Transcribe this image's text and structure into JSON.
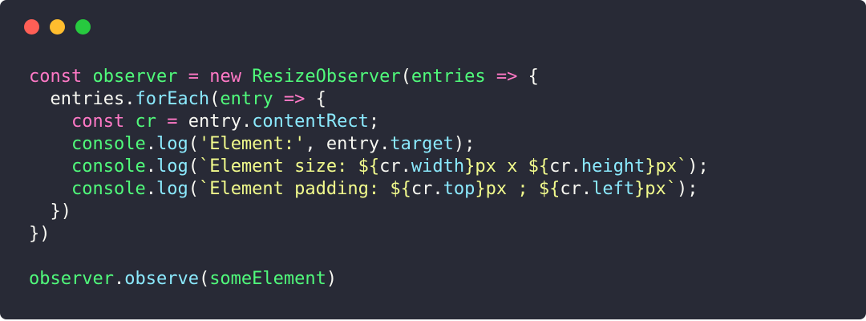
{
  "window": {
    "background": "#282a36",
    "traffic_lights": [
      {
        "name": "close",
        "color": "#ff5f56"
      },
      {
        "name": "minimize",
        "color": "#ffbd2e"
      },
      {
        "name": "maximize",
        "color": "#27c93f"
      }
    ]
  },
  "colors": {
    "plain": "#f8f8f2",
    "keyword": "#ff79c6",
    "function": "#50fa7b",
    "property": "#8be9fd",
    "string": "#f1fa8c"
  },
  "code_lines": [
    [
      {
        "text": "const",
        "kind": "keyword"
      },
      {
        "text": " ",
        "kind": "plain"
      },
      {
        "text": "observer",
        "kind": "function"
      },
      {
        "text": " ",
        "kind": "plain"
      },
      {
        "text": "=",
        "kind": "keyword"
      },
      {
        "text": " ",
        "kind": "plain"
      },
      {
        "text": "new",
        "kind": "keyword"
      },
      {
        "text": " ",
        "kind": "plain"
      },
      {
        "text": "ResizeObserver",
        "kind": "function"
      },
      {
        "text": "(",
        "kind": "plain"
      },
      {
        "text": "entries",
        "kind": "function"
      },
      {
        "text": " ",
        "kind": "plain"
      },
      {
        "text": "=>",
        "kind": "keyword"
      },
      {
        "text": " {",
        "kind": "plain"
      }
    ],
    [
      {
        "text": "  entries.",
        "kind": "plain"
      },
      {
        "text": "forEach",
        "kind": "property"
      },
      {
        "text": "(",
        "kind": "plain"
      },
      {
        "text": "entry",
        "kind": "function"
      },
      {
        "text": " ",
        "kind": "plain"
      },
      {
        "text": "=>",
        "kind": "keyword"
      },
      {
        "text": " {",
        "kind": "plain"
      }
    ],
    [
      {
        "text": "    ",
        "kind": "plain"
      },
      {
        "text": "const",
        "kind": "keyword"
      },
      {
        "text": " ",
        "kind": "plain"
      },
      {
        "text": "cr",
        "kind": "function"
      },
      {
        "text": " ",
        "kind": "plain"
      },
      {
        "text": "=",
        "kind": "keyword"
      },
      {
        "text": " entry.",
        "kind": "plain"
      },
      {
        "text": "contentRect",
        "kind": "property"
      },
      {
        "text": ";",
        "kind": "plain"
      }
    ],
    [
      {
        "text": "    ",
        "kind": "plain"
      },
      {
        "text": "console",
        "kind": "function"
      },
      {
        "text": ".",
        "kind": "plain"
      },
      {
        "text": "log",
        "kind": "property"
      },
      {
        "text": "(",
        "kind": "plain"
      },
      {
        "text": "'Element:'",
        "kind": "string"
      },
      {
        "text": ", entry.",
        "kind": "plain"
      },
      {
        "text": "target",
        "kind": "property"
      },
      {
        "text": ");",
        "kind": "plain"
      }
    ],
    [
      {
        "text": "    ",
        "kind": "plain"
      },
      {
        "text": "console",
        "kind": "function"
      },
      {
        "text": ".",
        "kind": "plain"
      },
      {
        "text": "log",
        "kind": "property"
      },
      {
        "text": "(",
        "kind": "plain"
      },
      {
        "text": "`Element size: ${",
        "kind": "string"
      },
      {
        "text": "cr.",
        "kind": "plain"
      },
      {
        "text": "width",
        "kind": "property"
      },
      {
        "text": "}px x ${",
        "kind": "string"
      },
      {
        "text": "cr.",
        "kind": "plain"
      },
      {
        "text": "height",
        "kind": "property"
      },
      {
        "text": "}px`",
        "kind": "string"
      },
      {
        "text": ");",
        "kind": "plain"
      }
    ],
    [
      {
        "text": "    ",
        "kind": "plain"
      },
      {
        "text": "console",
        "kind": "function"
      },
      {
        "text": ".",
        "kind": "plain"
      },
      {
        "text": "log",
        "kind": "property"
      },
      {
        "text": "(",
        "kind": "plain"
      },
      {
        "text": "`Element padding: ${",
        "kind": "string"
      },
      {
        "text": "cr.",
        "kind": "plain"
      },
      {
        "text": "top",
        "kind": "property"
      },
      {
        "text": "}px ; ${",
        "kind": "string"
      },
      {
        "text": "cr.",
        "kind": "plain"
      },
      {
        "text": "left",
        "kind": "property"
      },
      {
        "text": "}px`",
        "kind": "string"
      },
      {
        "text": ");",
        "kind": "plain"
      }
    ],
    [
      {
        "text": "  })",
        "kind": "plain"
      }
    ],
    [
      {
        "text": "})",
        "kind": "plain"
      }
    ],
    [],
    [
      {
        "text": "observer",
        "kind": "function"
      },
      {
        "text": ".",
        "kind": "plain"
      },
      {
        "text": "observe",
        "kind": "property"
      },
      {
        "text": "(",
        "kind": "plain"
      },
      {
        "text": "someElement",
        "kind": "function"
      },
      {
        "text": ")",
        "kind": "plain"
      }
    ]
  ]
}
